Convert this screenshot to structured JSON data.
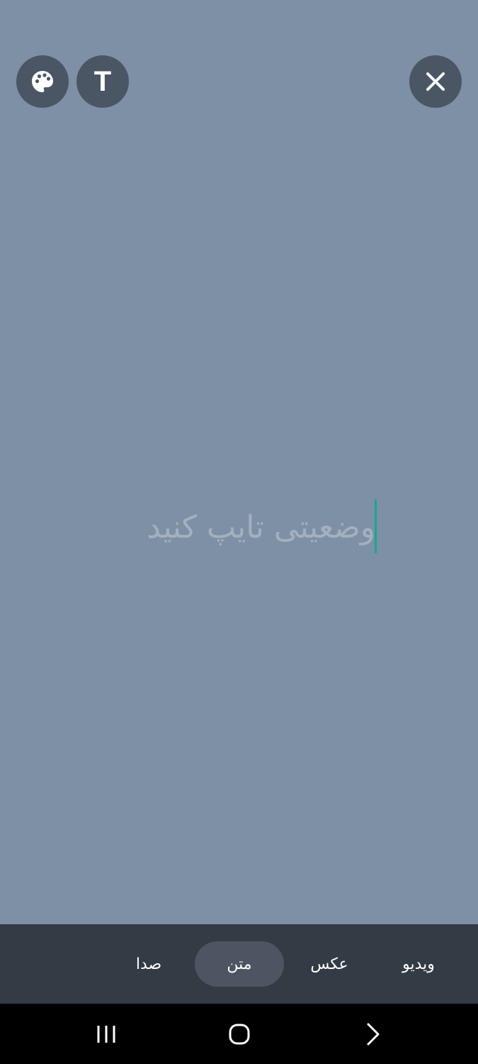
{
  "top_bar": {
    "palette_button": {
      "icon": "palette-icon"
    },
    "text_style_button": {
      "icon": "text-t-icon",
      "glyph": "T"
    },
    "close_button": {
      "icon": "close-icon"
    }
  },
  "editor": {
    "placeholder": "وضعیتی تایپ کنید",
    "value": "",
    "cursor_color": "#14a98f"
  },
  "tabs": [
    {
      "label": "صدا",
      "selected": false
    },
    {
      "label": "متن",
      "selected": true
    },
    {
      "label": "عکس",
      "selected": false
    },
    {
      "label": "ویدیو",
      "selected": false
    }
  ],
  "system_nav": {
    "recents": "recents-icon",
    "home": "home-icon",
    "back": "back-icon"
  },
  "colors": {
    "canvas_background": "#7e90a5",
    "round_button": "#4a5664",
    "tab_bar": "#333b45",
    "selected_tab": "#4c5561",
    "nav_bar": "#000000"
  }
}
